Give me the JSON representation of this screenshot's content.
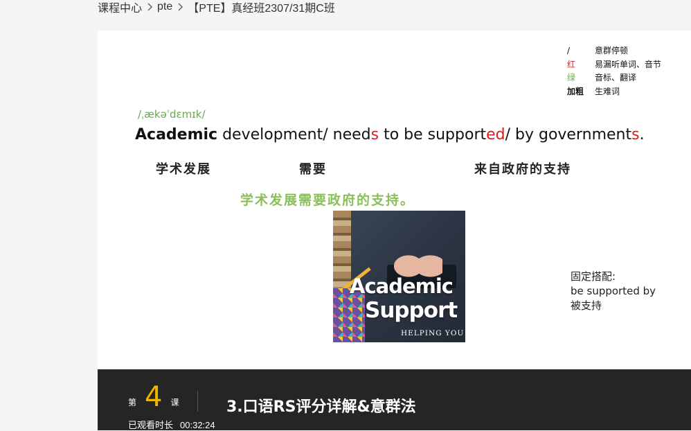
{
  "breadcrumb": {
    "items": [
      "课程中心",
      "pte",
      "【PTE】真经班2307/31期C班"
    ]
  },
  "legend": [
    {
      "key": "/",
      "desc": "意群停顿"
    },
    {
      "key": "红",
      "desc": "易漏听单词、音节"
    },
    {
      "key": "绿",
      "desc": "音标、翻译"
    },
    {
      "key": "加粗",
      "desc": "生难词"
    }
  ],
  "slide": {
    "phonetic": "/ˌækəˈdɛmɪk/",
    "sentence": {
      "s1": "Academic",
      "s2": " development/ need",
      "s3": "s",
      "s4": " to be support",
      "s5": "ed",
      "s6": "/ by government",
      "s7": "s",
      "s8": "."
    },
    "gloss": [
      "学术发展",
      "需要",
      "来自政府的支持"
    ],
    "translation": "学术发展需要政府的支持。",
    "image": {
      "title_line1": "Academic",
      "title_line2": "Support",
      "tagline": "HELPING YOU"
    },
    "note": {
      "heading": "固定搭配:",
      "phrase": "be supported by",
      "meaning": "被支持"
    }
  },
  "lesson": {
    "prefix": "第",
    "number": "4",
    "suffix": "课",
    "title": "3.口语RS评分详解&意群法",
    "watched_label": "已观看时长",
    "watched_time": "00:32:24"
  },
  "colors": {
    "accent_red": "#d41f1f",
    "accent_green": "#6aa84f",
    "lesson_number": "#f0b400",
    "bar_bg": "#252525"
  }
}
